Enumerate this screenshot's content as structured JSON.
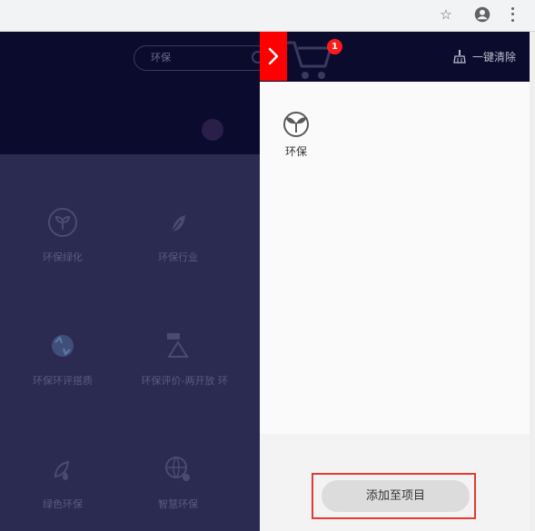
{
  "browser": {
    "icons": {
      "star": "star-icon",
      "account": "account-icon",
      "menu": "more-vert-icon"
    }
  },
  "page": {
    "search_placeholder": "环保",
    "categories": [
      {
        "label": "环保绿化",
        "icon": "sprout-circle-icon"
      },
      {
        "label": "环保行业",
        "icon": "leaf-drop-icon"
      },
      {
        "label": "环保环评搭质",
        "icon": "recycle-earth-icon"
      },
      {
        "label": "环保评价-两开放",
        "icon": "recycle-flag-icon"
      },
      {
        "label": "绿色环保",
        "icon": "leaf-water-icon"
      },
      {
        "label": "智慧环保",
        "icon": "globe-gear-icon"
      }
    ],
    "partial_label": "环"
  },
  "cart": {
    "count": "1",
    "clear_label": "一键清除",
    "items": [
      {
        "label": "环保",
        "icon": "sprout-icon"
      }
    ],
    "add_button_label": "添加至项目"
  },
  "colors": {
    "header_bg": "#0b0b2e",
    "overlay_bg": "#2b2a51",
    "toggle_red": "#ff0000",
    "badge_red": "#ff1a1a",
    "highlight_red": "#e53935"
  }
}
